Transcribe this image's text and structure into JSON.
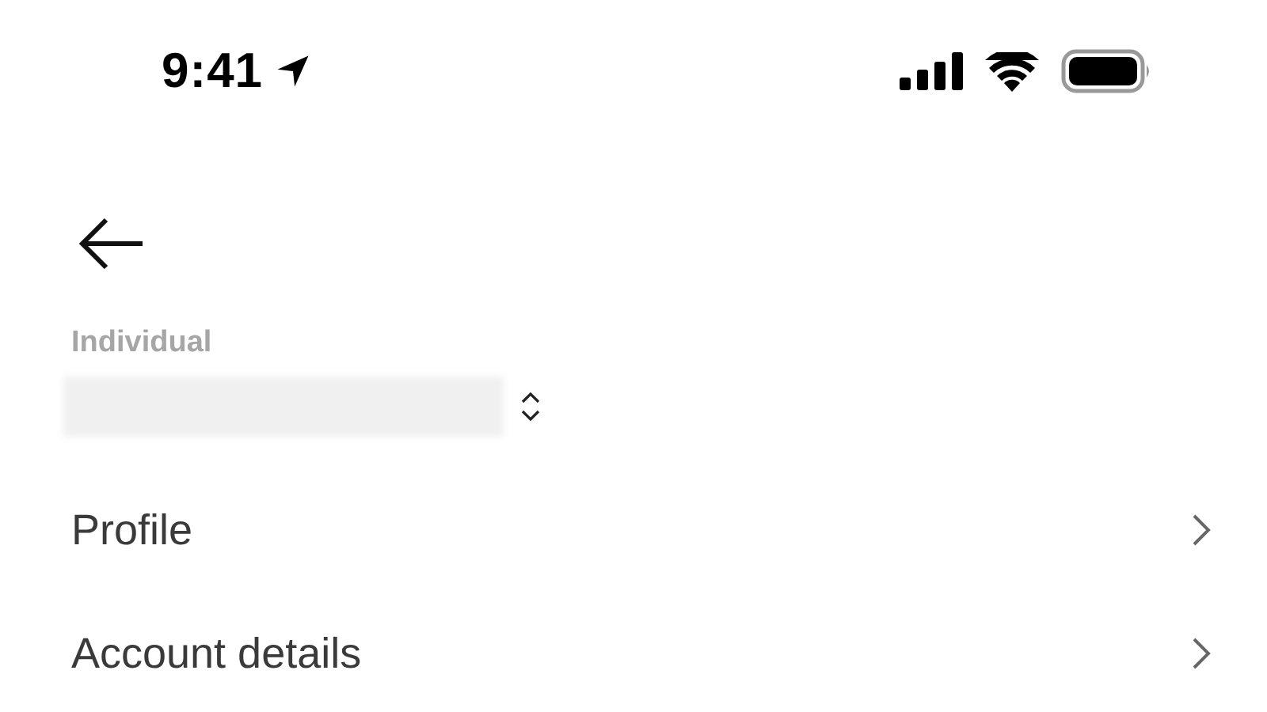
{
  "status_bar": {
    "time": "9:41"
  },
  "account": {
    "label": "Individual"
  },
  "menu": [
    {
      "label": "Profile"
    },
    {
      "label": "Account details"
    }
  ]
}
